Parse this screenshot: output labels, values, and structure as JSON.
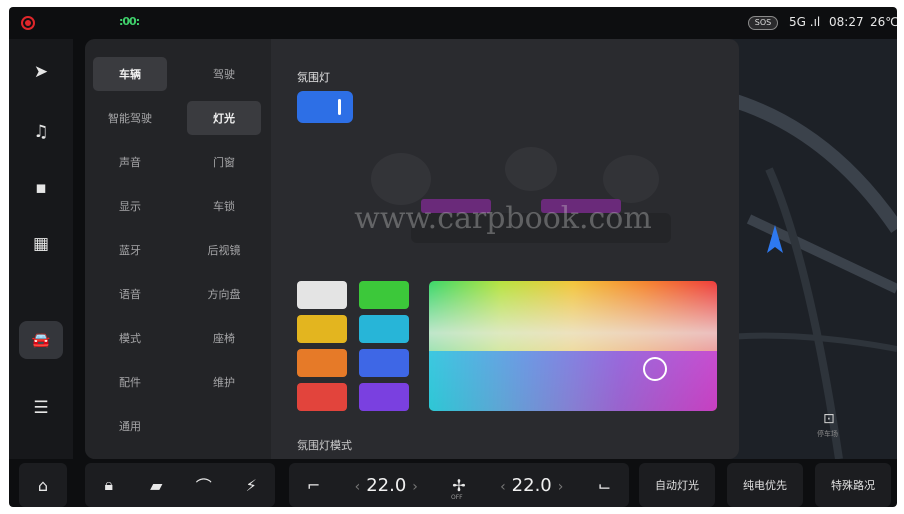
{
  "status": {
    "green_indicator": ":00:",
    "sos": "SOS",
    "network": "5G",
    "time": "08:27",
    "temperature": "26℃"
  },
  "sidebar": {
    "items": [
      {
        "icon": "navigation-icon",
        "glyph": "➤"
      },
      {
        "icon": "music-icon",
        "glyph": "♫"
      },
      {
        "icon": "camera-icon",
        "glyph": "▪"
      },
      {
        "icon": "apps-grid-icon",
        "glyph": "▦"
      },
      {
        "icon": "car-icon",
        "glyph": "🚘"
      },
      {
        "icon": "toggle-switches-icon",
        "glyph": "☰"
      }
    ]
  },
  "menu": {
    "items": [
      {
        "label": "车辆",
        "selected": true
      },
      {
        "label": "驾驶",
        "selected": false
      },
      {
        "label": "智能驾驶",
        "selected": false
      },
      {
        "label": "灯光",
        "selected": true
      },
      {
        "label": "声音",
        "selected": false
      },
      {
        "label": "门窗",
        "selected": false
      },
      {
        "label": "显示",
        "selected": false
      },
      {
        "label": "车锁",
        "selected": false
      },
      {
        "label": "蓝牙",
        "selected": false
      },
      {
        "label": "后视镜",
        "selected": false
      },
      {
        "label": "语音",
        "selected": false
      },
      {
        "label": "方向盘",
        "selected": false
      },
      {
        "label": "模式",
        "selected": false
      },
      {
        "label": "座椅",
        "selected": false
      },
      {
        "label": "配件",
        "selected": false
      },
      {
        "label": "维护",
        "selected": false
      },
      {
        "label": "通用",
        "selected": false
      }
    ]
  },
  "content": {
    "ambient_title": "氛围灯",
    "toggle_on": true,
    "watermark": "www.carpbook.com",
    "swatches": [
      "#e4e4e4",
      "#3cc83a",
      "#e3b51f",
      "#27b5d8",
      "#e67a28",
      "#3e67e6",
      "#e2443c",
      "#7a40e0"
    ],
    "mode_title": "氛围灯模式"
  },
  "map": {
    "parking_label": "停车场"
  },
  "bottombar": {
    "home_icon": "home-icon",
    "left_temp": "22.0",
    "right_temp": "22.0",
    "fan_label": "OFF",
    "btn_auto_light": "自动灯光",
    "btn_ev_priority": "纯电优先",
    "btn_special_road": "特殊路况"
  },
  "colors": {
    "accent": "#2d6fe6",
    "background": "#0d0e10",
    "panel": "#1f2023"
  }
}
